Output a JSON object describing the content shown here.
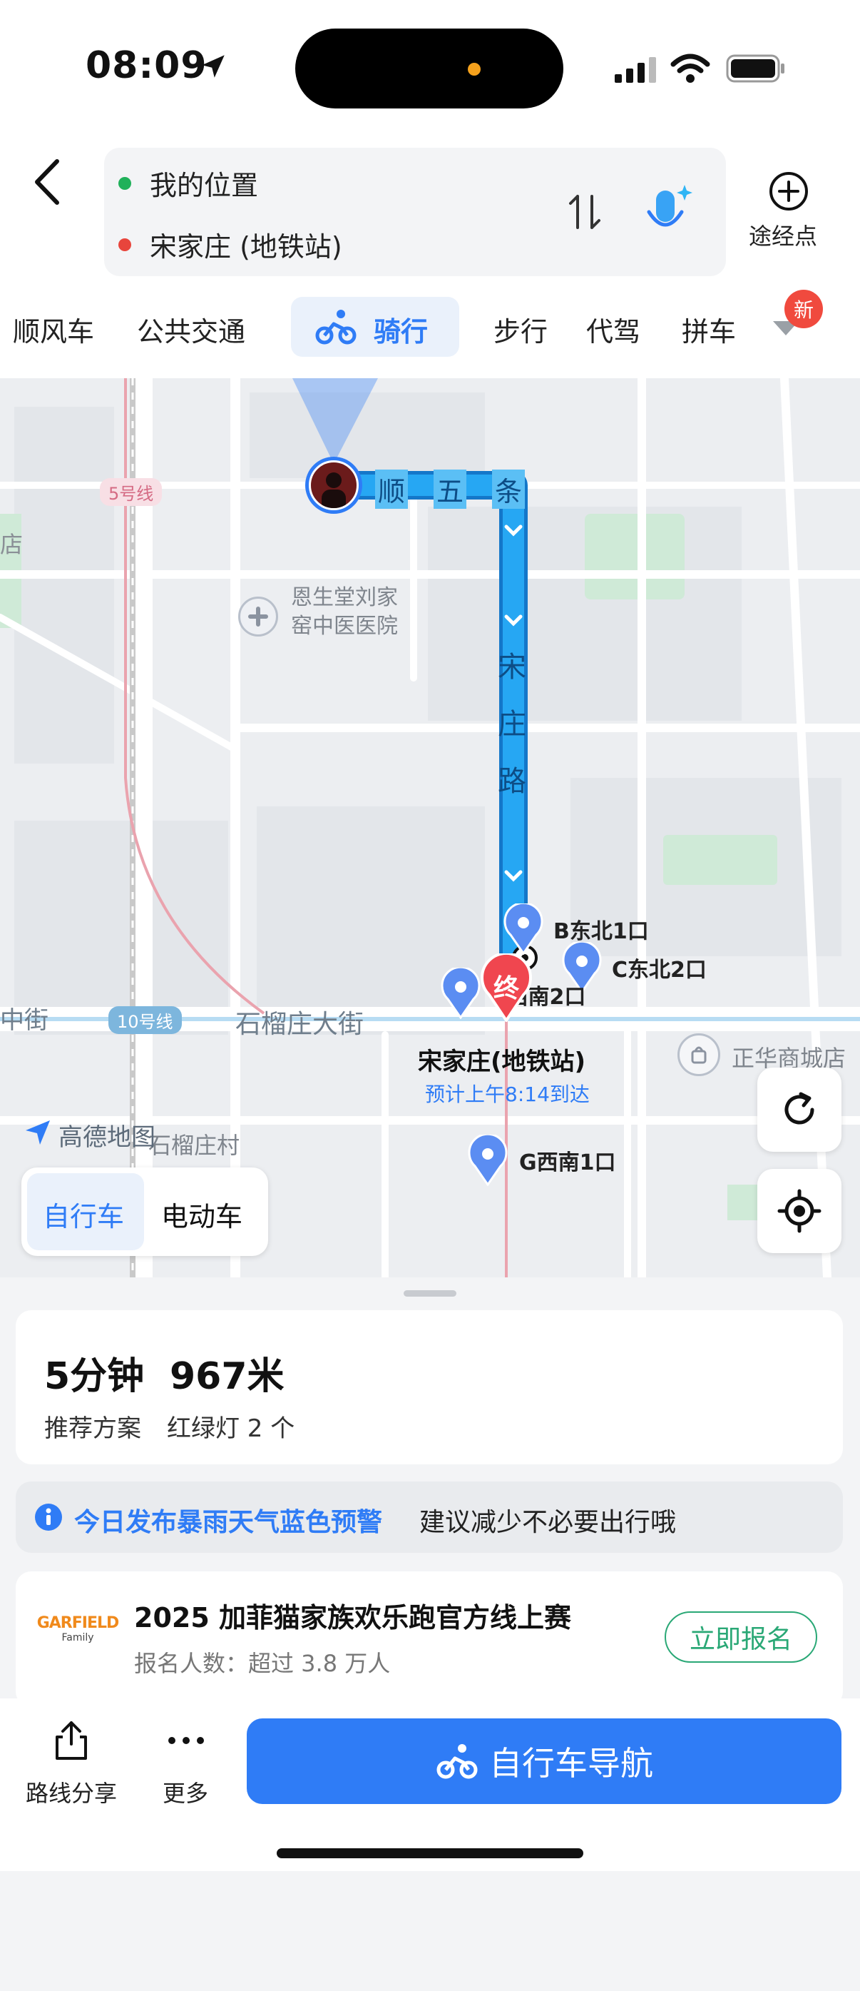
{
  "status": {
    "time": "08:09"
  },
  "header": {
    "origin": "我的位置",
    "destination": "宋家庄 (地铁站)",
    "waypoint_label": "途经点",
    "colors": {
      "origin_dot": "#20b15a",
      "destination_dot": "#e8453c"
    }
  },
  "tabs": {
    "items": [
      "顺风车",
      "公共交通",
      "骑行",
      "步行",
      "代驾",
      "拼车"
    ],
    "active": "骑行",
    "new_badge": "新"
  },
  "map": {
    "labels": {
      "line5": "5号线",
      "line10": "10号线",
      "shop_left": "店",
      "hospital": [
        "恩生堂刘家",
        "窑中医医院"
      ],
      "street_top": [
        "顺",
        "五",
        "条"
      ],
      "street_vertical": [
        "宋",
        "庄",
        "路"
      ],
      "street_horizontal": "石榴庄大街",
      "street_left": "中街",
      "exit_b": "B东北1口",
      "exit_c": "C东北2口",
      "exit_f": "F西南2口",
      "exit_g": "G西南1口",
      "end_marker": "终",
      "station": "宋家庄(地铁站)",
      "eta": "预计上午8:14到达",
      "mall": "正华商城店",
      "village": "石榴庄村",
      "logo": "高德地图"
    },
    "vehicle_toggle": {
      "options": [
        "自行车",
        "电动车"
      ],
      "selected": "自行车"
    },
    "colors": {
      "route": "#1ea0f2",
      "accent": "#2f7cf6"
    }
  },
  "summary": {
    "time": "5分钟",
    "distance": "967米",
    "recommend": "推荐方案",
    "lights": "红绿灯 2 个"
  },
  "alert": {
    "highlight": "今日发布暴雨天气蓝色预警",
    "text": "建议减少不必要出行哦"
  },
  "promo": {
    "logo_text": "GARFIELD",
    "logo_sub": "Family",
    "title": "2025 加菲猫家族欢乐跑官方线上赛",
    "subtitle": "报名人数：超过 3.8 万人",
    "button": "立即报名"
  },
  "bottom": {
    "share": "路线分享",
    "more": "更多",
    "navigate": "自行车导航"
  }
}
